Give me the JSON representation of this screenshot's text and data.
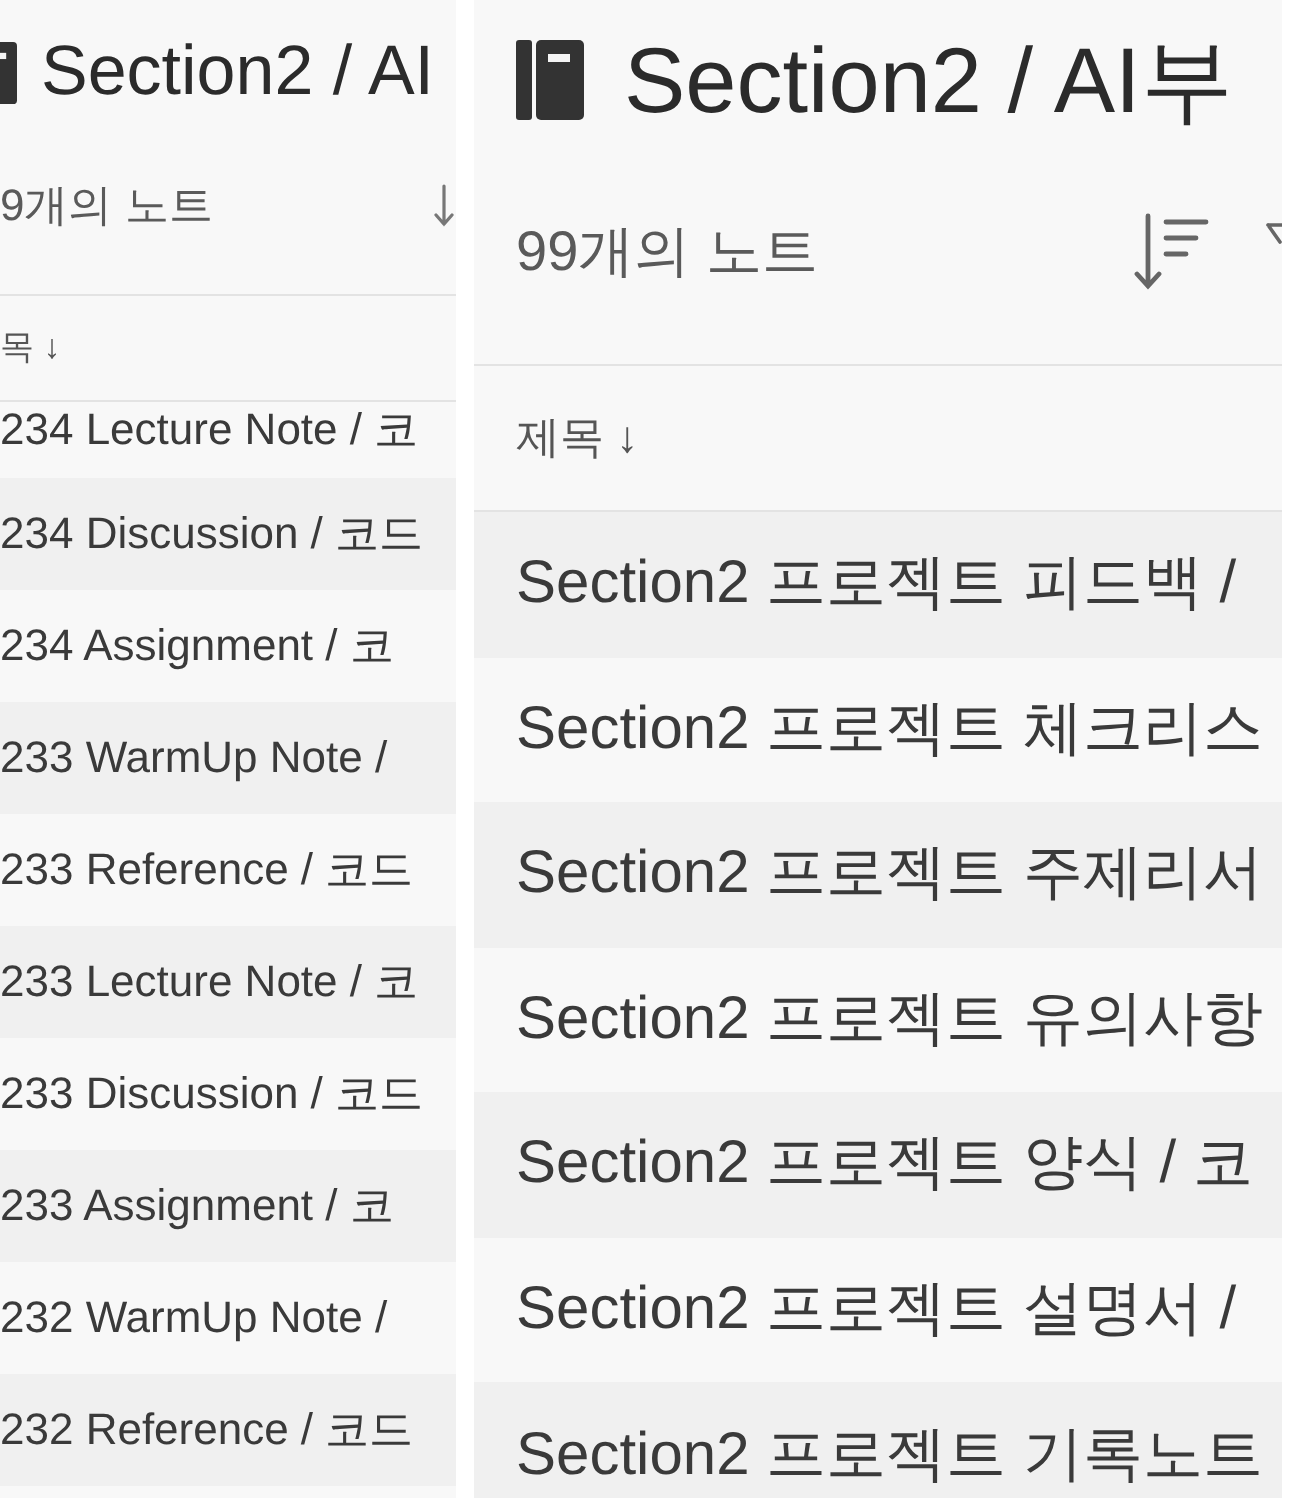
{
  "panels": [
    {
      "title": "Section2 / AI",
      "note_count": "9개의 노트",
      "column_header": "목 ↓",
      "notes": [
        "234 Lecture Note / 코",
        "234 Discussion / 코드",
        "234 Assignment / 코",
        "233 WarmUp Note /",
        "233 Reference / 코드",
        "233 Lecture Note / 코",
        "233 Discussion / 코드",
        "233 Assignment / 코",
        "232 WarmUp Note /",
        "232 Reference / 코드"
      ]
    },
    {
      "title": "Section2 / AI부",
      "note_count": "99개의 노트",
      "column_header": "제목 ↓",
      "notes": [
        "Section2 프로젝트 피드백 /",
        "Section2 프로젝트 체크리스",
        "Section2 프로젝트 주제리서",
        "Section2 프로젝트 유의사항",
        "Section2 프로젝트 양식 / 코",
        "Section2 프로젝트 설명서 /",
        "Section2 프로젝트 기록노트"
      ]
    }
  ]
}
